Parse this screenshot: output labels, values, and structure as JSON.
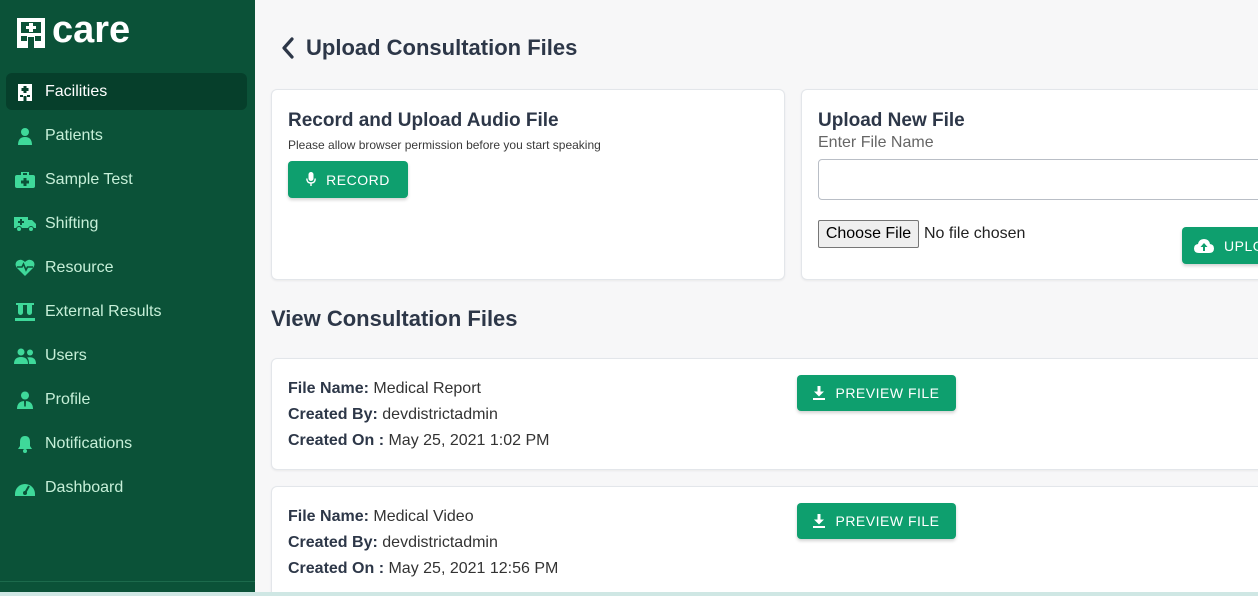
{
  "app": {
    "logo_text": "care"
  },
  "sidebar": {
    "items": [
      {
        "label": "Facilities",
        "icon": "hospital-icon",
        "active": true
      },
      {
        "label": "Patients",
        "icon": "patient-icon"
      },
      {
        "label": "Sample Test",
        "icon": "medkit-icon"
      },
      {
        "label": "Shifting",
        "icon": "ambulance-icon"
      },
      {
        "label": "Resource",
        "icon": "heartbeat-icon"
      },
      {
        "label": "External Results",
        "icon": "test-tubes-icon"
      },
      {
        "label": "Users",
        "icon": "users-icon"
      },
      {
        "label": "Profile",
        "icon": "user-tie-icon"
      },
      {
        "label": "Notifications",
        "icon": "bell-icon"
      },
      {
        "label": "Dashboard",
        "icon": "tachometer-icon"
      }
    ]
  },
  "header": {
    "title": "Upload Consultation Files"
  },
  "record_card": {
    "title": "Record and Upload Audio File",
    "hint": "Please allow browser permission before you start speaking",
    "record_label": "RECORD"
  },
  "upload_card": {
    "title": "Upload New File",
    "field_label": "Enter File Name",
    "field_value": "",
    "choose_label": "Choose File",
    "no_file_text": "No file chosen",
    "upload_label": "UPLO"
  },
  "files_section": {
    "title": "View Consultation Files",
    "name_label": "File Name:",
    "by_label": "Created By:",
    "on_label": "Created On :",
    "preview_label": "PREVIEW FILE",
    "files": [
      {
        "name": "Medical Report",
        "created_by": "devdistrictadmin",
        "created_on": "May 25, 2021 1:02 PM"
      },
      {
        "name": "Medical Video",
        "created_by": "devdistrictadmin",
        "created_on": "May 25, 2021 12:56 PM"
      }
    ]
  },
  "colors": {
    "sidebar_bg": "#0b5238",
    "accent": "#0e9f6e",
    "active_item": "#063f2b"
  }
}
